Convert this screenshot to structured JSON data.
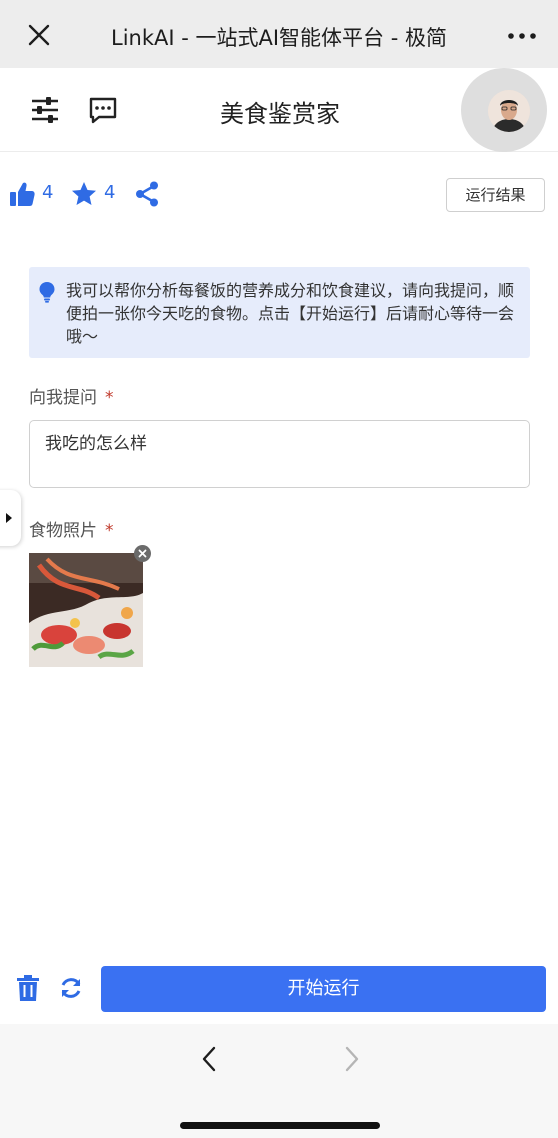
{
  "browser": {
    "title": "LinkAI - 一站式AI智能体平台 - 极简"
  },
  "header": {
    "title": "美食鉴赏家"
  },
  "stats": {
    "likes": "4",
    "favorites": "4"
  },
  "result_button": "运行结果",
  "info_text": "我可以帮你分析每餐饭的营养成分和饮食建议，请向我提问，顺便拍一张你今天吃的食物。点击【开始运行】后请耐心等待一会哦～",
  "question": {
    "label": "向我提问",
    "required_mark": "*",
    "value": "我吃的怎么样"
  },
  "photo": {
    "label": "食物照片",
    "required_mark": "*"
  },
  "run_button": "开始运行",
  "colors": {
    "accent": "#3a71f2",
    "icon_blue": "#2f6be4",
    "info_bg": "#e6ecfb"
  }
}
